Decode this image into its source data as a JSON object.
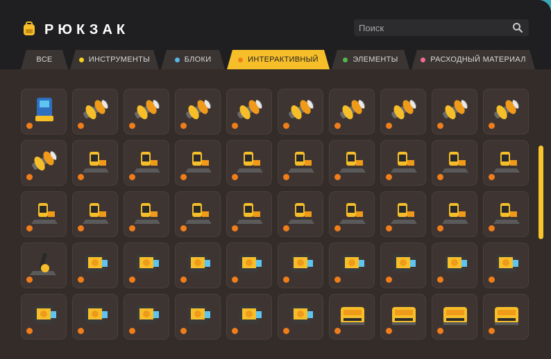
{
  "header": {
    "title": "РЮКЗАК",
    "logo_icon": "backpack-icon"
  },
  "search": {
    "placeholder": "Поиск",
    "value": "",
    "icon": "search-icon"
  },
  "tabs": [
    {
      "label": "ВСЕ",
      "dot": ""
    },
    {
      "label": "ИНСТРУМЕНТЫ",
      "dot": "#f2d21e"
    },
    {
      "label": "БЛОКИ",
      "dot": "#5cb4e8"
    },
    {
      "label": "ИНТЕРАКТИВНЫЙ",
      "dot": "#f07d1a"
    },
    {
      "label": "ЭЛЕМЕНТЫ",
      "dot": "#52b848"
    },
    {
      "label": "РАСХОДНЫЙ МАТЕРИАЛ",
      "dot": "#f26b91"
    }
  ],
  "active_tab": "ИНТЕРАКТИВНЫЙ",
  "colors": {
    "accent": "#f6bf2a",
    "panel": "#1f1f21",
    "content": "#342c29",
    "item_dot": "#f07d1a"
  },
  "inventory": {
    "slot_count": 50,
    "item_icons": [
      "controller-icon",
      "bearing-icon",
      "bearing-icon",
      "bearing-icon",
      "bearing-icon",
      "bearing-icon",
      "bearing-icon",
      "bearing-icon",
      "bearing-icon",
      "bearing-icon",
      "bearing-icon",
      "seat-icon",
      "seat-icon",
      "seat-icon",
      "seat-icon",
      "seat-icon",
      "seat-icon",
      "seat-icon",
      "seat-icon",
      "seat-icon",
      "seat-icon",
      "seat-icon",
      "seat-icon",
      "seat-icon",
      "seat-icon",
      "seat-icon",
      "seat-icon",
      "seat-icon",
      "seat-icon",
      "seat-icon",
      "lever-icon",
      "engine-icon",
      "engine-icon",
      "engine-icon",
      "engine-icon",
      "engine-icon",
      "engine-icon",
      "engine-icon",
      "engine-icon",
      "engine-icon",
      "engine-icon",
      "engine-icon",
      "engine-icon",
      "engine-icon",
      "engine-icon",
      "engine-icon",
      "tank-icon",
      "tank-icon",
      "tank-icon",
      "tank-icon"
    ]
  },
  "scroll": {
    "position_fraction": 0.0
  }
}
